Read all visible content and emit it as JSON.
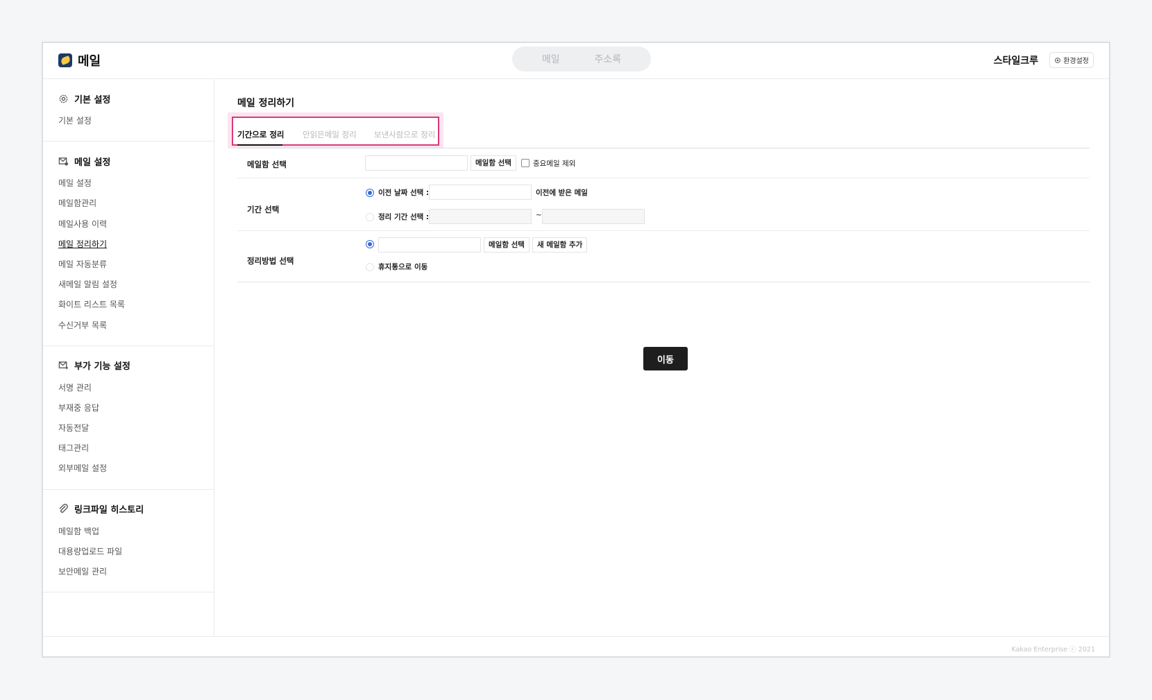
{
  "header": {
    "logo_text": "메일",
    "tabs": [
      {
        "label": "메일"
      },
      {
        "label": "주소록"
      }
    ],
    "user_name": "스타일크루",
    "settings_label": "환경설정"
  },
  "sidebar": {
    "sections": [
      {
        "title": "기본 설정",
        "icon": "gear-icon",
        "items": [
          "기본 설정"
        ]
      },
      {
        "title": "메일 설정",
        "icon": "mail-settings-icon",
        "items": [
          "메일 설정",
          "메일함관리",
          "메일사용 이력",
          "메일 정리하기",
          "메일 자동분류",
          "새메일 알림 설정",
          "화이트 리스트 목록",
          "수신거부 목록"
        ]
      },
      {
        "title": "부가 기능 설정",
        "icon": "mail-plus-icon",
        "items": [
          "서명 관리",
          "부재중 응답",
          "자동전달",
          "태그관리",
          "외부메일 설정"
        ]
      },
      {
        "title": "링크파일 히스토리",
        "icon": "paperclip-icon",
        "items": [
          "메일함 백업",
          "대용량업로드 파일",
          "보안메일 관리"
        ]
      }
    ],
    "active_item": "메일 정리하기"
  },
  "main": {
    "page_title": "메일 정리하기",
    "tabs": [
      {
        "label": "기간으로 정리",
        "active": true
      },
      {
        "label": "안읽은메일 정리",
        "active": false
      },
      {
        "label": "보낸사람으로 정리",
        "active": false
      }
    ],
    "form": {
      "mailbox_label": "메일함 선택",
      "mailbox_select_button": "메일함 선택",
      "exclude_important_label": "중요메일 제외",
      "period_label": "기간 선택",
      "before_date_label": "이전 날짜 선택 :",
      "before_date_suffix": "이전에 받은 메일",
      "range_label": "정리 기간 선택 :",
      "range_separator": "~",
      "method_label": "정리방법 선택",
      "method_select_button": "메일함 선택",
      "new_mailbox_button": "새 메일함 추가",
      "trash_label": "휴지통으로 이동"
    },
    "submit_label": "이동"
  },
  "footer": {
    "copyright": "Kakao Enterprise ⓒ 2021"
  },
  "colors": {
    "highlight": "#fbe5ee",
    "highlight_border": "#d63a78",
    "radio": "#2f6ad9",
    "primary_button": "#1e1e1e"
  }
}
